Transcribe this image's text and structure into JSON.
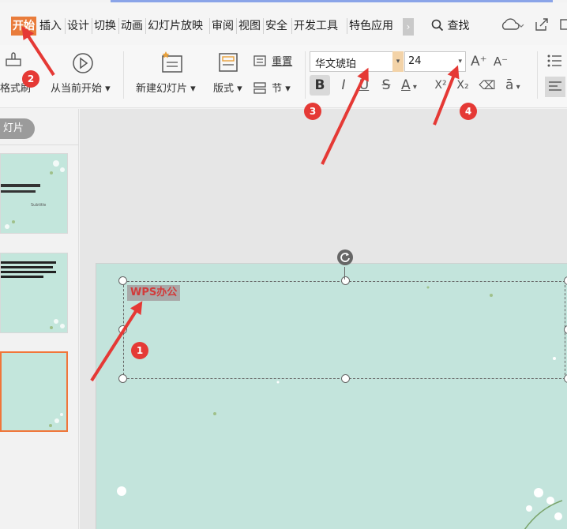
{
  "menu": {
    "tabs": [
      "开始",
      "插入",
      "设计",
      "切换",
      "动画",
      "幻灯片放映",
      "审阅",
      "视图",
      "安全",
      "开发工具",
      "特色应用"
    ],
    "more": "›",
    "search_label": "查找"
  },
  "ribbon": {
    "format_painter_label": "格式刷",
    "play_from_current_label": "从当前开始",
    "new_slide_label": "新建幻灯片",
    "layout_label": "版式",
    "reset_label": "重置",
    "section_label": "节",
    "font_name": "华文琥珀",
    "font_size": "24",
    "bold_label": "B",
    "italic_label": "I",
    "underline_label": "U",
    "strike_label": "S",
    "font_color_label": "A",
    "superscript_label": "X²",
    "subscript_label": "X₂",
    "increase_font_label": "A⁺",
    "decrease_font_label": "A⁻",
    "clear_format_label": "⌫",
    "char_spacing_label": "ā"
  },
  "left_panel": {
    "slides_tab_label": "灯片",
    "thumb1_subtitle": "Subtitle"
  },
  "slide": {
    "textbox_text": "WPS办公"
  },
  "annotations": [
    "1",
    "2",
    "3",
    "4"
  ],
  "colors": {
    "accent": "#e97c3b",
    "annotation": "#e53935",
    "slide_bg": "#c3e4dc",
    "active_thumb_border": "#f0763a"
  }
}
